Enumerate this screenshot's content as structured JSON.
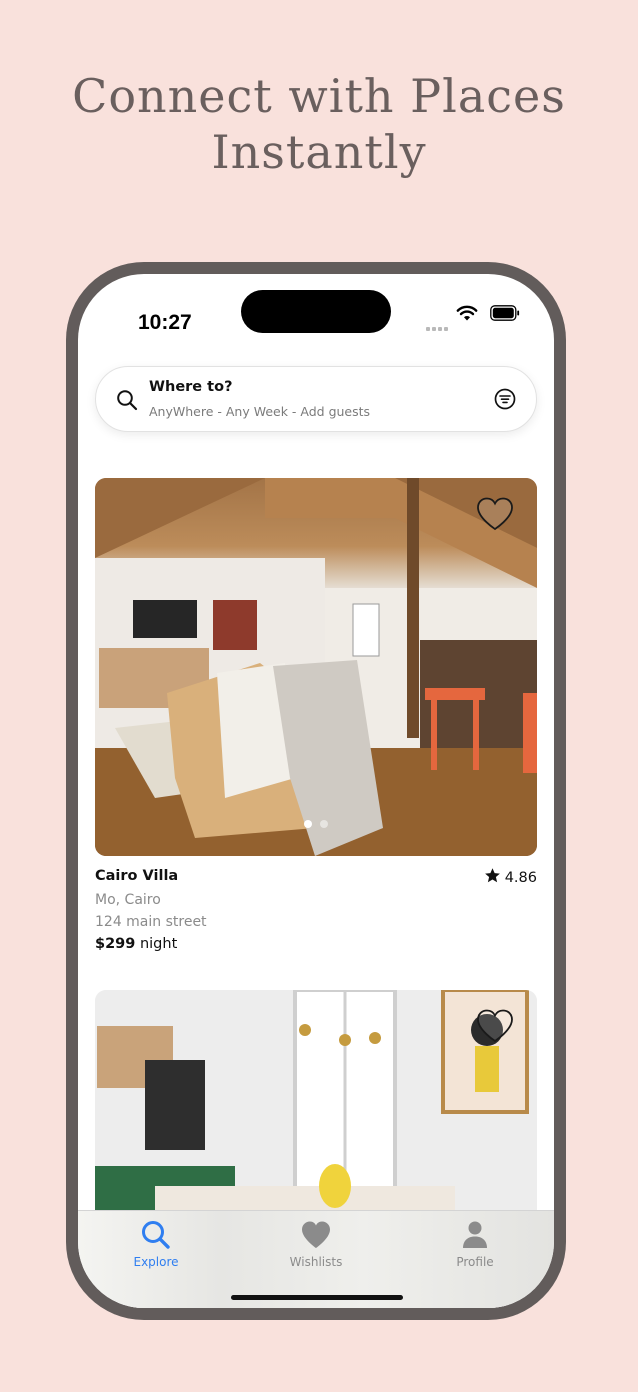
{
  "headline": {
    "line1": "Connect with Places",
    "line2": "Instantly"
  },
  "status_bar": {
    "time": "10:27"
  },
  "search": {
    "title": "Where to?",
    "subtitle": "AnyWhere - Any Week - Add guests"
  },
  "listings": [
    {
      "title": "Cairo Villa",
      "rating": "4.86",
      "location": "Mo, Cairo",
      "address": "124 main street",
      "price": "$299",
      "price_unit": "night",
      "photo_index": 1,
      "photo_count": 2
    },
    {
      "title": "",
      "photo_index": 1,
      "photo_count": 1
    }
  ],
  "tabs": [
    {
      "label": "Explore",
      "icon": "search-icon",
      "active": true
    },
    {
      "label": "Wishlists",
      "icon": "heart-icon",
      "active": false
    },
    {
      "label": "Profile",
      "icon": "person-icon",
      "active": false
    }
  ],
  "colors": {
    "background": "#f9e1dc",
    "phone_frame": "#625c5b",
    "accent": "#2f7ef0",
    "tab_inactive": "#8b8b8b"
  }
}
